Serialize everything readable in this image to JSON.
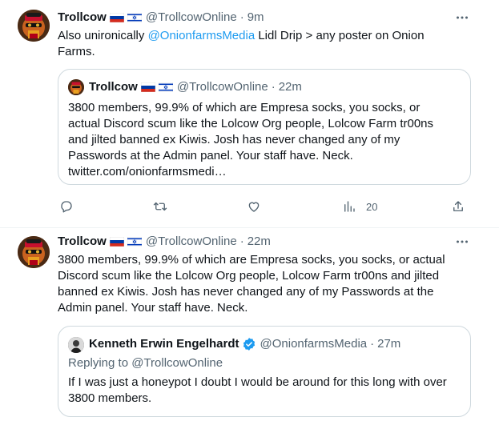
{
  "tweets": [
    {
      "author": {
        "name": "Trollcow",
        "handle": "@TrollcowOnline",
        "flag_icons": [
          "russia-flag-icon",
          "israel-flag-icon"
        ]
      },
      "time": "9m",
      "text_before": "Also unironically ",
      "mention": "@OnionfarmsMedia",
      "text_after": " Lidl Drip > any poster on Onion",
      "text_line2": "Farms.",
      "more_icon": "more-dots-icon",
      "quote": {
        "author_name": "Trollcow",
        "author_handle": "@TrollcowOnline",
        "time": "22m",
        "lines": [
          "3800 members, 99.9% of which are Empresa socks, you socks, or",
          "actual Discord scum like the Lolcow Org people, Lolcow Farm tr00ns",
          "and jilted banned ex Kiwis. Josh has never changed any of my",
          "Passwords at the Admin panel. Your staff have. Neck.",
          "twitter.com/onionfarmsmedi…"
        ]
      },
      "actions": {
        "reply_icon": "reply-icon",
        "retweet_icon": "retweet-icon",
        "like_icon": "heart-icon",
        "views_icon": "views-icon",
        "views_count": "20",
        "share_icon": "share-icon"
      }
    },
    {
      "author": {
        "name": "Trollcow",
        "handle": "@TrollcowOnline",
        "flag_icons": [
          "russia-flag-icon",
          "israel-flag-icon"
        ]
      },
      "time": "22m",
      "lines": [
        "3800 members, 99.9% of which are Empresa socks, you socks, or actual",
        "Discord scum like the Lolcow Org people, Lolcow Farm tr00ns and jilted",
        "banned ex Kiwis. Josh has never changed any of my Passwords at the",
        "Admin panel. Your staff have. Neck."
      ],
      "more_icon": "more-dots-icon",
      "quote": {
        "author_name": "Kenneth Erwin Engelhardt",
        "author_handle": "@OnionfarmsMedia",
        "time": "27m",
        "verified_icon": "verified-badge-icon",
        "replying_prefix": "Replying to ",
        "replying_to": "@TrollcowOnline",
        "lines": [
          "If I was just a honeypot I doubt I would be around for this long with over",
          "3800 members."
        ]
      }
    }
  ],
  "colors": {
    "accent": "#1d9bf0",
    "text": "#0f1419",
    "muted": "#536471",
    "border": "#cfd9de"
  }
}
